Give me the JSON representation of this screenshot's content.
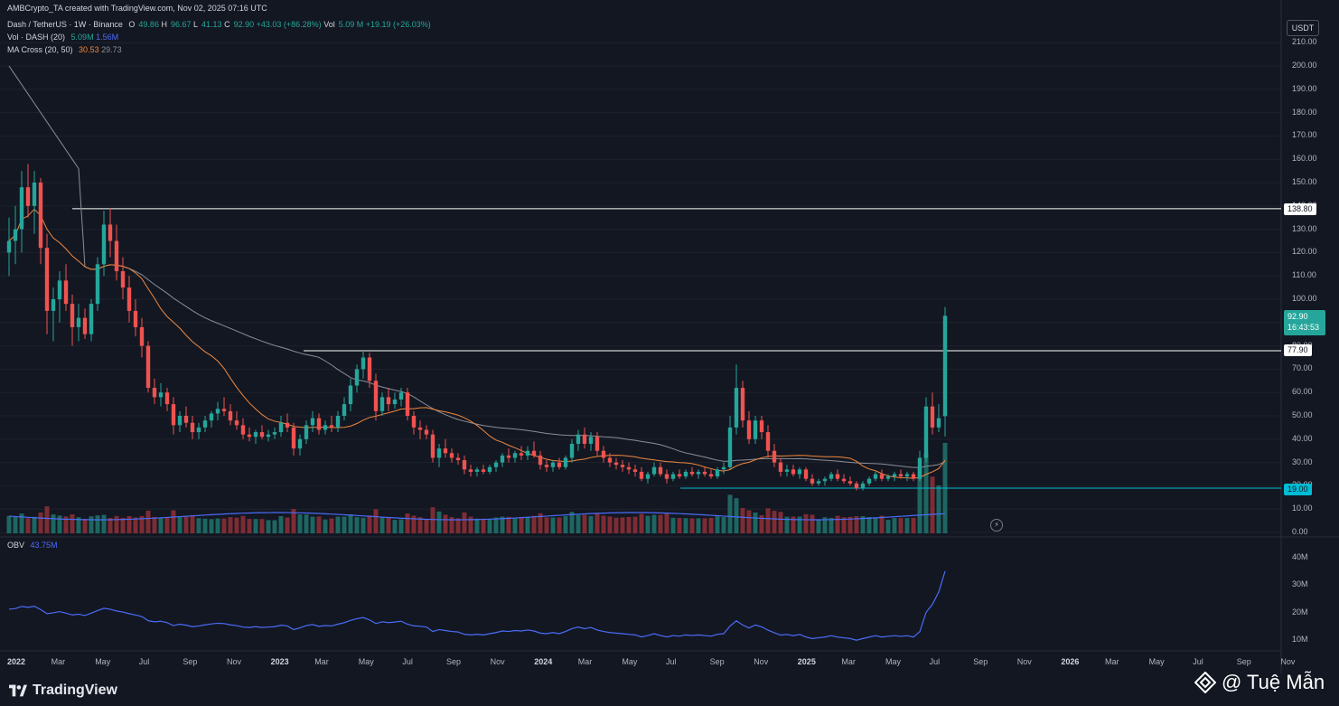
{
  "header": {
    "credit": "AMBCrypto_TA created with TradingView.com, Nov 02, 2025 07:16 UTC"
  },
  "legend": {
    "symbol": "Dash / TetherUS · 1W · Binance",
    "ohlc": {
      "o_label": "O",
      "o": "49.86",
      "h_label": "H",
      "h": "96.67",
      "l_label": "L",
      "l": "41.13",
      "c_label": "C",
      "c": "92.90",
      "change": "+43.03 (+86.28%)",
      "vol_label": "Vol",
      "vol": "5.09 M",
      "vol_change": "+19.19 (+26.03%)"
    },
    "volume_indicator": {
      "name": "Vol · DASH (20)",
      "v1": "5.09M",
      "v2": "1.56M"
    },
    "ma_cross": {
      "name": "MA Cross (20, 50)",
      "v1": "30.53",
      "v2": "29.73"
    },
    "obv": {
      "name": "OBV",
      "value": "43.75M"
    }
  },
  "price_axis": {
    "currency": "USDT",
    "labels": [
      "210.00",
      "200.00",
      "190.00",
      "180.00",
      "170.00",
      "160.00",
      "150.00",
      "140.00",
      "130.00",
      "120.00",
      "110.00",
      "100.00",
      "90.00",
      "80.00",
      "70.00",
      "60.00",
      "50.00",
      "40.00",
      "30.00",
      "20.00",
      "10.00",
      "0.00"
    ],
    "level_high": "138.80",
    "level_mid": "77.90",
    "level_low": "19.00",
    "current_price": "92.90",
    "countdown": "16:43:53"
  },
  "obv_axis": {
    "labels": [
      "40M",
      "30M",
      "20M",
      "10M"
    ]
  },
  "time_axis": {
    "labels": [
      "2022",
      "Mar",
      "May",
      "Jul",
      "Sep",
      "Nov",
      "2023",
      "Mar",
      "May",
      "Jul",
      "Sep",
      "Nov",
      "2024",
      "Mar",
      "May",
      "Jul",
      "Sep",
      "Nov",
      "2025",
      "Mar",
      "May",
      "Jul",
      "Sep",
      "Nov",
      "2026",
      "Mar",
      "May",
      "Jul",
      "Sep",
      "Nov"
    ],
    "bold": [
      "2022",
      "2023",
      "2024",
      "2025",
      "2026"
    ]
  },
  "branding": {
    "logo_text": "TradingView",
    "watermark": "@ Tuệ Mẫn"
  },
  "colors": {
    "background": "#131722",
    "up": "#26a69a",
    "down": "#ef5350",
    "ma_fast": "#f0883e",
    "ma_slow": "#8a8e97",
    "obv_line": "#4a6cf7",
    "level_line_white": "#ffffff",
    "level_line_cyan": "#00bcd4"
  },
  "chart_data": {
    "type": "candlestick",
    "timeframe": "1W",
    "x_range": [
      "2022-01",
      "2025-11"
    ],
    "ylim": [
      0,
      215
    ],
    "levels": [
      138.8,
      77.9,
      19.0
    ],
    "candles": [
      {
        "o": 120,
        "h": 135,
        "l": 110,
        "c": 125
      },
      {
        "o": 125,
        "h": 140,
        "l": 115,
        "c": 130
      },
      {
        "o": 130,
        "h": 155,
        "l": 120,
        "c": 148
      },
      {
        "o": 148,
        "h": 158,
        "l": 135,
        "c": 140
      },
      {
        "o": 140,
        "h": 155,
        "l": 128,
        "c": 150
      },
      {
        "o": 150,
        "h": 152,
        "l": 115,
        "c": 122
      },
      {
        "o": 122,
        "h": 128,
        "l": 85,
        "c": 95
      },
      {
        "o": 95,
        "h": 105,
        "l": 82,
        "c": 100
      },
      {
        "o": 100,
        "h": 112,
        "l": 90,
        "c": 108
      },
      {
        "o": 108,
        "h": 115,
        "l": 95,
        "c": 98
      },
      {
        "o": 98,
        "h": 102,
        "l": 80,
        "c": 88
      },
      {
        "o": 88,
        "h": 98,
        "l": 82,
        "c": 92
      },
      {
        "o": 92,
        "h": 96,
        "l": 83,
        "c": 85
      },
      {
        "o": 85,
        "h": 100,
        "l": 82,
        "c": 98
      },
      {
        "o": 98,
        "h": 118,
        "l": 95,
        "c": 115
      },
      {
        "o": 115,
        "h": 138,
        "l": 110,
        "c": 132
      },
      {
        "o": 132,
        "h": 139,
        "l": 118,
        "c": 125
      },
      {
        "o": 125,
        "h": 132,
        "l": 108,
        "c": 112
      },
      {
        "o": 112,
        "h": 118,
        "l": 100,
        "c": 105
      },
      {
        "o": 105,
        "h": 110,
        "l": 90,
        "c": 95
      },
      {
        "o": 95,
        "h": 100,
        "l": 84,
        "c": 88
      },
      {
        "o": 88,
        "h": 92,
        "l": 75,
        "c": 80
      },
      {
        "o": 80,
        "h": 82,
        "l": 60,
        "c": 62
      },
      {
        "o": 62,
        "h": 66,
        "l": 55,
        "c": 58
      },
      {
        "o": 58,
        "h": 64,
        "l": 54,
        "c": 60
      },
      {
        "o": 60,
        "h": 62,
        "l": 52,
        "c": 55
      },
      {
        "o": 55,
        "h": 58,
        "l": 42,
        "c": 46
      },
      {
        "o": 46,
        "h": 52,
        "l": 43,
        "c": 50
      },
      {
        "o": 50,
        "h": 54,
        "l": 45,
        "c": 47
      },
      {
        "o": 47,
        "h": 50,
        "l": 40,
        "c": 43
      },
      {
        "o": 43,
        "h": 47,
        "l": 40,
        "c": 45
      },
      {
        "o": 45,
        "h": 50,
        "l": 43,
        "c": 48
      },
      {
        "o": 48,
        "h": 52,
        "l": 45,
        "c": 51
      },
      {
        "o": 51,
        "h": 56,
        "l": 48,
        "c": 53
      },
      {
        "o": 53,
        "h": 58,
        "l": 50,
        "c": 52
      },
      {
        "o": 52,
        "h": 55,
        "l": 46,
        "c": 48
      },
      {
        "o": 48,
        "h": 52,
        "l": 44,
        "c": 46
      },
      {
        "o": 46,
        "h": 49,
        "l": 40,
        "c": 42
      },
      {
        "o": 42,
        "h": 45,
        "l": 39,
        "c": 41
      },
      {
        "o": 41,
        "h": 44,
        "l": 38,
        "c": 43
      },
      {
        "o": 43,
        "h": 46,
        "l": 40,
        "c": 41
      },
      {
        "o": 41,
        "h": 44,
        "l": 39,
        "c": 42
      },
      {
        "o": 42,
        "h": 45,
        "l": 40,
        "c": 43
      },
      {
        "o": 43,
        "h": 50,
        "l": 41,
        "c": 47
      },
      {
        "o": 47,
        "h": 51,
        "l": 43,
        "c": 45
      },
      {
        "o": 45,
        "h": 47,
        "l": 33,
        "c": 36
      },
      {
        "o": 36,
        "h": 42,
        "l": 33,
        "c": 40
      },
      {
        "o": 40,
        "h": 48,
        "l": 38,
        "c": 46
      },
      {
        "o": 46,
        "h": 52,
        "l": 43,
        "c": 49
      },
      {
        "o": 49,
        "h": 51,
        "l": 42,
        "c": 44
      },
      {
        "o": 44,
        "h": 48,
        "l": 42,
        "c": 46
      },
      {
        "o": 46,
        "h": 50,
        "l": 43,
        "c": 45
      },
      {
        "o": 45,
        "h": 52,
        "l": 43,
        "c": 50
      },
      {
        "o": 50,
        "h": 58,
        "l": 48,
        "c": 55
      },
      {
        "o": 55,
        "h": 66,
        "l": 52,
        "c": 63
      },
      {
        "o": 63,
        "h": 72,
        "l": 60,
        "c": 70
      },
      {
        "o": 70,
        "h": 78,
        "l": 66,
        "c": 75
      },
      {
        "o": 75,
        "h": 77,
        "l": 62,
        "c": 65
      },
      {
        "o": 65,
        "h": 68,
        "l": 48,
        "c": 52
      },
      {
        "o": 52,
        "h": 60,
        "l": 50,
        "c": 58
      },
      {
        "o": 58,
        "h": 62,
        "l": 52,
        "c": 55
      },
      {
        "o": 55,
        "h": 60,
        "l": 53,
        "c": 57
      },
      {
        "o": 57,
        "h": 62,
        "l": 54,
        "c": 60
      },
      {
        "o": 60,
        "h": 62,
        "l": 48,
        "c": 50
      },
      {
        "o": 50,
        "h": 52,
        "l": 42,
        "c": 45
      },
      {
        "o": 45,
        "h": 48,
        "l": 40,
        "c": 44
      },
      {
        "o": 44,
        "h": 46,
        "l": 40,
        "c": 42
      },
      {
        "o": 42,
        "h": 44,
        "l": 30,
        "c": 32
      },
      {
        "o": 32,
        "h": 38,
        "l": 28,
        "c": 36
      },
      {
        "o": 36,
        "h": 40,
        "l": 32,
        "c": 34
      },
      {
        "o": 34,
        "h": 36,
        "l": 30,
        "c": 32
      },
      {
        "o": 32,
        "h": 34,
        "l": 29,
        "c": 31
      },
      {
        "o": 31,
        "h": 33,
        "l": 25,
        "c": 27
      },
      {
        "o": 27,
        "h": 29,
        "l": 24,
        "c": 26
      },
      {
        "o": 26,
        "h": 28,
        "l": 24,
        "c": 27
      },
      {
        "o": 27,
        "h": 29,
        "l": 25,
        "c": 26
      },
      {
        "o": 26,
        "h": 29,
        "l": 25,
        "c": 28
      },
      {
        "o": 28,
        "h": 31,
        "l": 26,
        "c": 30
      },
      {
        "o": 30,
        "h": 34,
        "l": 28,
        "c": 33
      },
      {
        "o": 33,
        "h": 36,
        "l": 30,
        "c": 32
      },
      {
        "o": 32,
        "h": 35,
        "l": 30,
        "c": 34
      },
      {
        "o": 34,
        "h": 37,
        "l": 31,
        "c": 33
      },
      {
        "o": 33,
        "h": 37,
        "l": 31,
        "c": 35
      },
      {
        "o": 35,
        "h": 39,
        "l": 32,
        "c": 33
      },
      {
        "o": 33,
        "h": 35,
        "l": 27,
        "c": 29
      },
      {
        "o": 29,
        "h": 31,
        "l": 26,
        "c": 28
      },
      {
        "o": 28,
        "h": 31,
        "l": 26,
        "c": 30
      },
      {
        "o": 30,
        "h": 32,
        "l": 27,
        "c": 28
      },
      {
        "o": 28,
        "h": 33,
        "l": 27,
        "c": 32
      },
      {
        "o": 32,
        "h": 40,
        "l": 30,
        "c": 38
      },
      {
        "o": 38,
        "h": 44,
        "l": 35,
        "c": 42
      },
      {
        "o": 42,
        "h": 45,
        "l": 36,
        "c": 38
      },
      {
        "o": 38,
        "h": 43,
        "l": 35,
        "c": 41
      },
      {
        "o": 41,
        "h": 43,
        "l": 33,
        "c": 35
      },
      {
        "o": 35,
        "h": 37,
        "l": 30,
        "c": 32
      },
      {
        "o": 32,
        "h": 34,
        "l": 28,
        "c": 30
      },
      {
        "o": 30,
        "h": 32,
        "l": 27,
        "c": 29
      },
      {
        "o": 29,
        "h": 31,
        "l": 26,
        "c": 28
      },
      {
        "o": 28,
        "h": 30,
        "l": 25,
        "c": 27
      },
      {
        "o": 27,
        "h": 29,
        "l": 24,
        "c": 26
      },
      {
        "o": 26,
        "h": 28,
        "l": 22,
        "c": 23
      },
      {
        "o": 23,
        "h": 26,
        "l": 21,
        "c": 25
      },
      {
        "o": 25,
        "h": 30,
        "l": 24,
        "c": 28
      },
      {
        "o": 28,
        "h": 30,
        "l": 24,
        "c": 25
      },
      {
        "o": 25,
        "h": 27,
        "l": 21,
        "c": 23
      },
      {
        "o": 23,
        "h": 26,
        "l": 22,
        "c": 25
      },
      {
        "o": 25,
        "h": 27,
        "l": 23,
        "c": 24
      },
      {
        "o": 24,
        "h": 27,
        "l": 23,
        "c": 26
      },
      {
        "o": 26,
        "h": 28,
        "l": 24,
        "c": 25
      },
      {
        "o": 25,
        "h": 27,
        "l": 23,
        "c": 26
      },
      {
        "o": 26,
        "h": 28,
        "l": 24,
        "c": 25
      },
      {
        "o": 25,
        "h": 27,
        "l": 23,
        "c": 24
      },
      {
        "o": 24,
        "h": 28,
        "l": 23,
        "c": 27
      },
      {
        "o": 27,
        "h": 30,
        "l": 25,
        "c": 28
      },
      {
        "o": 28,
        "h": 50,
        "l": 27,
        "c": 45
      },
      {
        "o": 45,
        "h": 72,
        "l": 42,
        "c": 62
      },
      {
        "o": 62,
        "h": 65,
        "l": 45,
        "c": 48
      },
      {
        "o": 48,
        "h": 52,
        "l": 38,
        "c": 40
      },
      {
        "o": 40,
        "h": 50,
        "l": 38,
        "c": 48
      },
      {
        "o": 48,
        "h": 50,
        "l": 40,
        "c": 43
      },
      {
        "o": 43,
        "h": 46,
        "l": 32,
        "c": 35
      },
      {
        "o": 35,
        "h": 38,
        "l": 28,
        "c": 30
      },
      {
        "o": 30,
        "h": 32,
        "l": 24,
        "c": 26
      },
      {
        "o": 26,
        "h": 29,
        "l": 24,
        "c": 27
      },
      {
        "o": 27,
        "h": 29,
        "l": 24,
        "c": 25
      },
      {
        "o": 25,
        "h": 28,
        "l": 23,
        "c": 27
      },
      {
        "o": 27,
        "h": 28,
        "l": 22,
        "c": 23
      },
      {
        "o": 23,
        "h": 25,
        "l": 20,
        "c": 21
      },
      {
        "o": 21,
        "h": 23,
        "l": 20,
        "c": 22
      },
      {
        "o": 22,
        "h": 24,
        "l": 20,
        "c": 23
      },
      {
        "o": 23,
        "h": 26,
        "l": 22,
        "c": 25
      },
      {
        "o": 25,
        "h": 27,
        "l": 22,
        "c": 23
      },
      {
        "o": 23,
        "h": 25,
        "l": 21,
        "c": 22
      },
      {
        "o": 22,
        "h": 24,
        "l": 20,
        "c": 21
      },
      {
        "o": 21,
        "h": 22,
        "l": 18,
        "c": 19
      },
      {
        "o": 19,
        "h": 22,
        "l": 18,
        "c": 21
      },
      {
        "o": 21,
        "h": 24,
        "l": 20,
        "c": 23
      },
      {
        "o": 23,
        "h": 26,
        "l": 22,
        "c": 25
      },
      {
        "o": 25,
        "h": 27,
        "l": 22,
        "c": 23
      },
      {
        "o": 23,
        "h": 25,
        "l": 22,
        "c": 24
      },
      {
        "o": 24,
        "h": 26,
        "l": 22,
        "c": 25
      },
      {
        "o": 25,
        "h": 27,
        "l": 23,
        "c": 24
      },
      {
        "o": 24,
        "h": 26,
        "l": 22,
        "c": 25
      },
      {
        "o": 25,
        "h": 26,
        "l": 22,
        "c": 23
      },
      {
        "o": 23,
        "h": 35,
        "l": 22,
        "c": 32
      },
      {
        "o": 32,
        "h": 58,
        "l": 30,
        "c": 54
      },
      {
        "o": 54,
        "h": 60,
        "l": 42,
        "c": 45
      },
      {
        "o": 45,
        "h": 55,
        "l": 43,
        "c": 49
      },
      {
        "o": 49.86,
        "h": 96.67,
        "l": 41.13,
        "c": 92.9
      }
    ]
  }
}
